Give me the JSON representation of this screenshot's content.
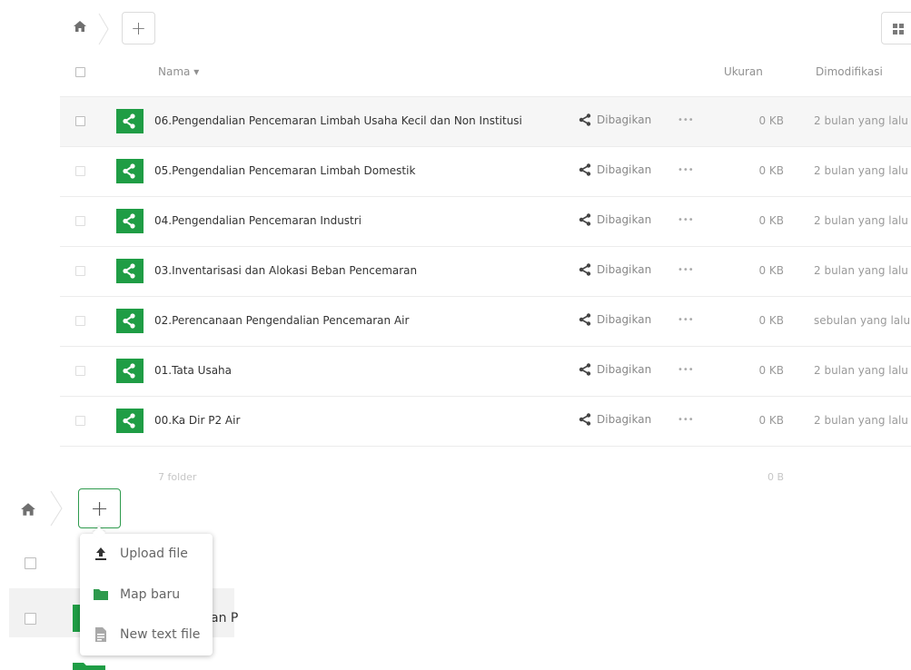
{
  "top": {
    "new_label": "+",
    "view_icon": "grid-view-icon"
  },
  "table": {
    "headers": {
      "name": "Nama ▾",
      "size": "Ukuran",
      "modified": "Dimodifikasi"
    },
    "rows": [
      {
        "name": "06.Pengendalian Pencemaran Limbah Usaha Kecil dan Non Institusi",
        "share": "Dibagikan",
        "more": "•••",
        "size": "0 KB",
        "modified": "2 bulan yang lalu"
      },
      {
        "name": "05.Pengendalian Pencemaran Limbah Domestik",
        "share": "Dibagikan",
        "more": "•••",
        "size": "0 KB",
        "modified": "2 bulan yang lalu"
      },
      {
        "name": "04.Pengendalian Pencemaran Industri",
        "share": "Dibagikan",
        "more": "•••",
        "size": "0 KB",
        "modified": "2 bulan yang lalu"
      },
      {
        "name": "03.Inventarisasi dan Alokasi Beban Pencemaran",
        "share": "Dibagikan",
        "more": "•••",
        "size": "0 KB",
        "modified": "2 bulan yang lalu"
      },
      {
        "name": "02.Perencanaan Pengendalian Pencemaran Air",
        "share": "Dibagikan",
        "more": "•••",
        "size": "0 KB",
        "modified": "sebulan yang lalu"
      },
      {
        "name": "01.Tata Usaha",
        "share": "Dibagikan",
        "more": "•••",
        "size": "0 KB",
        "modified": "2 bulan yang lalu"
      },
      {
        "name": "00.Ka Dir P2 Air",
        "share": "Dibagikan",
        "more": "•••",
        "size": "0 KB",
        "modified": "2 bulan yang lalu"
      }
    ],
    "summary": {
      "count": "7 folder",
      "total": "0 B"
    }
  },
  "zoom": {
    "new_label": "+",
    "partial_name": "an P",
    "menu": [
      {
        "label": "Upload file",
        "icon": "upload-icon"
      },
      {
        "label": "Map baru",
        "icon": "folder-icon"
      },
      {
        "label": "New text file",
        "icon": "text-file-icon"
      }
    ]
  },
  "colors": {
    "folder_green": "#1f9d45",
    "accent_green": "#2e9a4d"
  }
}
